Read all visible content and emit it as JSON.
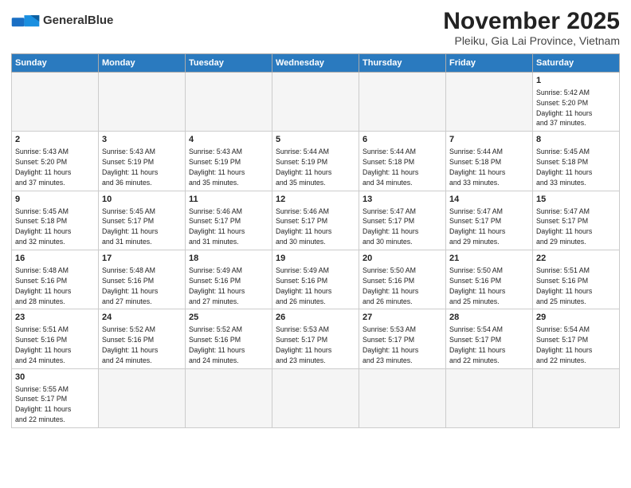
{
  "header": {
    "logo_general": "General",
    "logo_blue": "Blue",
    "month_title": "November 2025",
    "location": "Pleiku, Gia Lai Province, Vietnam"
  },
  "weekdays": [
    "Sunday",
    "Monday",
    "Tuesday",
    "Wednesday",
    "Thursday",
    "Friday",
    "Saturday"
  ],
  "weeks": [
    [
      {
        "day": "",
        "info": ""
      },
      {
        "day": "",
        "info": ""
      },
      {
        "day": "",
        "info": ""
      },
      {
        "day": "",
        "info": ""
      },
      {
        "day": "",
        "info": ""
      },
      {
        "day": "",
        "info": ""
      },
      {
        "day": "1",
        "info": "Sunrise: 5:42 AM\nSunset: 5:20 PM\nDaylight: 11 hours\nand 37 minutes."
      }
    ],
    [
      {
        "day": "2",
        "info": "Sunrise: 5:43 AM\nSunset: 5:20 PM\nDaylight: 11 hours\nand 37 minutes."
      },
      {
        "day": "3",
        "info": "Sunrise: 5:43 AM\nSunset: 5:19 PM\nDaylight: 11 hours\nand 36 minutes."
      },
      {
        "day": "4",
        "info": "Sunrise: 5:43 AM\nSunset: 5:19 PM\nDaylight: 11 hours\nand 35 minutes."
      },
      {
        "day": "5",
        "info": "Sunrise: 5:44 AM\nSunset: 5:19 PM\nDaylight: 11 hours\nand 35 minutes."
      },
      {
        "day": "6",
        "info": "Sunrise: 5:44 AM\nSunset: 5:18 PM\nDaylight: 11 hours\nand 34 minutes."
      },
      {
        "day": "7",
        "info": "Sunrise: 5:44 AM\nSunset: 5:18 PM\nDaylight: 11 hours\nand 33 minutes."
      },
      {
        "day": "8",
        "info": "Sunrise: 5:45 AM\nSunset: 5:18 PM\nDaylight: 11 hours\nand 33 minutes."
      }
    ],
    [
      {
        "day": "9",
        "info": "Sunrise: 5:45 AM\nSunset: 5:18 PM\nDaylight: 11 hours\nand 32 minutes."
      },
      {
        "day": "10",
        "info": "Sunrise: 5:45 AM\nSunset: 5:17 PM\nDaylight: 11 hours\nand 31 minutes."
      },
      {
        "day": "11",
        "info": "Sunrise: 5:46 AM\nSunset: 5:17 PM\nDaylight: 11 hours\nand 31 minutes."
      },
      {
        "day": "12",
        "info": "Sunrise: 5:46 AM\nSunset: 5:17 PM\nDaylight: 11 hours\nand 30 minutes."
      },
      {
        "day": "13",
        "info": "Sunrise: 5:47 AM\nSunset: 5:17 PM\nDaylight: 11 hours\nand 30 minutes."
      },
      {
        "day": "14",
        "info": "Sunrise: 5:47 AM\nSunset: 5:17 PM\nDaylight: 11 hours\nand 29 minutes."
      },
      {
        "day": "15",
        "info": "Sunrise: 5:47 AM\nSunset: 5:17 PM\nDaylight: 11 hours\nand 29 minutes."
      }
    ],
    [
      {
        "day": "16",
        "info": "Sunrise: 5:48 AM\nSunset: 5:16 PM\nDaylight: 11 hours\nand 28 minutes."
      },
      {
        "day": "17",
        "info": "Sunrise: 5:48 AM\nSunset: 5:16 PM\nDaylight: 11 hours\nand 27 minutes."
      },
      {
        "day": "18",
        "info": "Sunrise: 5:49 AM\nSunset: 5:16 PM\nDaylight: 11 hours\nand 27 minutes."
      },
      {
        "day": "19",
        "info": "Sunrise: 5:49 AM\nSunset: 5:16 PM\nDaylight: 11 hours\nand 26 minutes."
      },
      {
        "day": "20",
        "info": "Sunrise: 5:50 AM\nSunset: 5:16 PM\nDaylight: 11 hours\nand 26 minutes."
      },
      {
        "day": "21",
        "info": "Sunrise: 5:50 AM\nSunset: 5:16 PM\nDaylight: 11 hours\nand 25 minutes."
      },
      {
        "day": "22",
        "info": "Sunrise: 5:51 AM\nSunset: 5:16 PM\nDaylight: 11 hours\nand 25 minutes."
      }
    ],
    [
      {
        "day": "23",
        "info": "Sunrise: 5:51 AM\nSunset: 5:16 PM\nDaylight: 11 hours\nand 24 minutes."
      },
      {
        "day": "24",
        "info": "Sunrise: 5:52 AM\nSunset: 5:16 PM\nDaylight: 11 hours\nand 24 minutes."
      },
      {
        "day": "25",
        "info": "Sunrise: 5:52 AM\nSunset: 5:16 PM\nDaylight: 11 hours\nand 24 minutes."
      },
      {
        "day": "26",
        "info": "Sunrise: 5:53 AM\nSunset: 5:17 PM\nDaylight: 11 hours\nand 23 minutes."
      },
      {
        "day": "27",
        "info": "Sunrise: 5:53 AM\nSunset: 5:17 PM\nDaylight: 11 hours\nand 23 minutes."
      },
      {
        "day": "28",
        "info": "Sunrise: 5:54 AM\nSunset: 5:17 PM\nDaylight: 11 hours\nand 22 minutes."
      },
      {
        "day": "29",
        "info": "Sunrise: 5:54 AM\nSunset: 5:17 PM\nDaylight: 11 hours\nand 22 minutes."
      }
    ],
    [
      {
        "day": "30",
        "info": "Sunrise: 5:55 AM\nSunset: 5:17 PM\nDaylight: 11 hours\nand 22 minutes."
      },
      {
        "day": "",
        "info": ""
      },
      {
        "day": "",
        "info": ""
      },
      {
        "day": "",
        "info": ""
      },
      {
        "day": "",
        "info": ""
      },
      {
        "day": "",
        "info": ""
      },
      {
        "day": "",
        "info": ""
      }
    ]
  ]
}
